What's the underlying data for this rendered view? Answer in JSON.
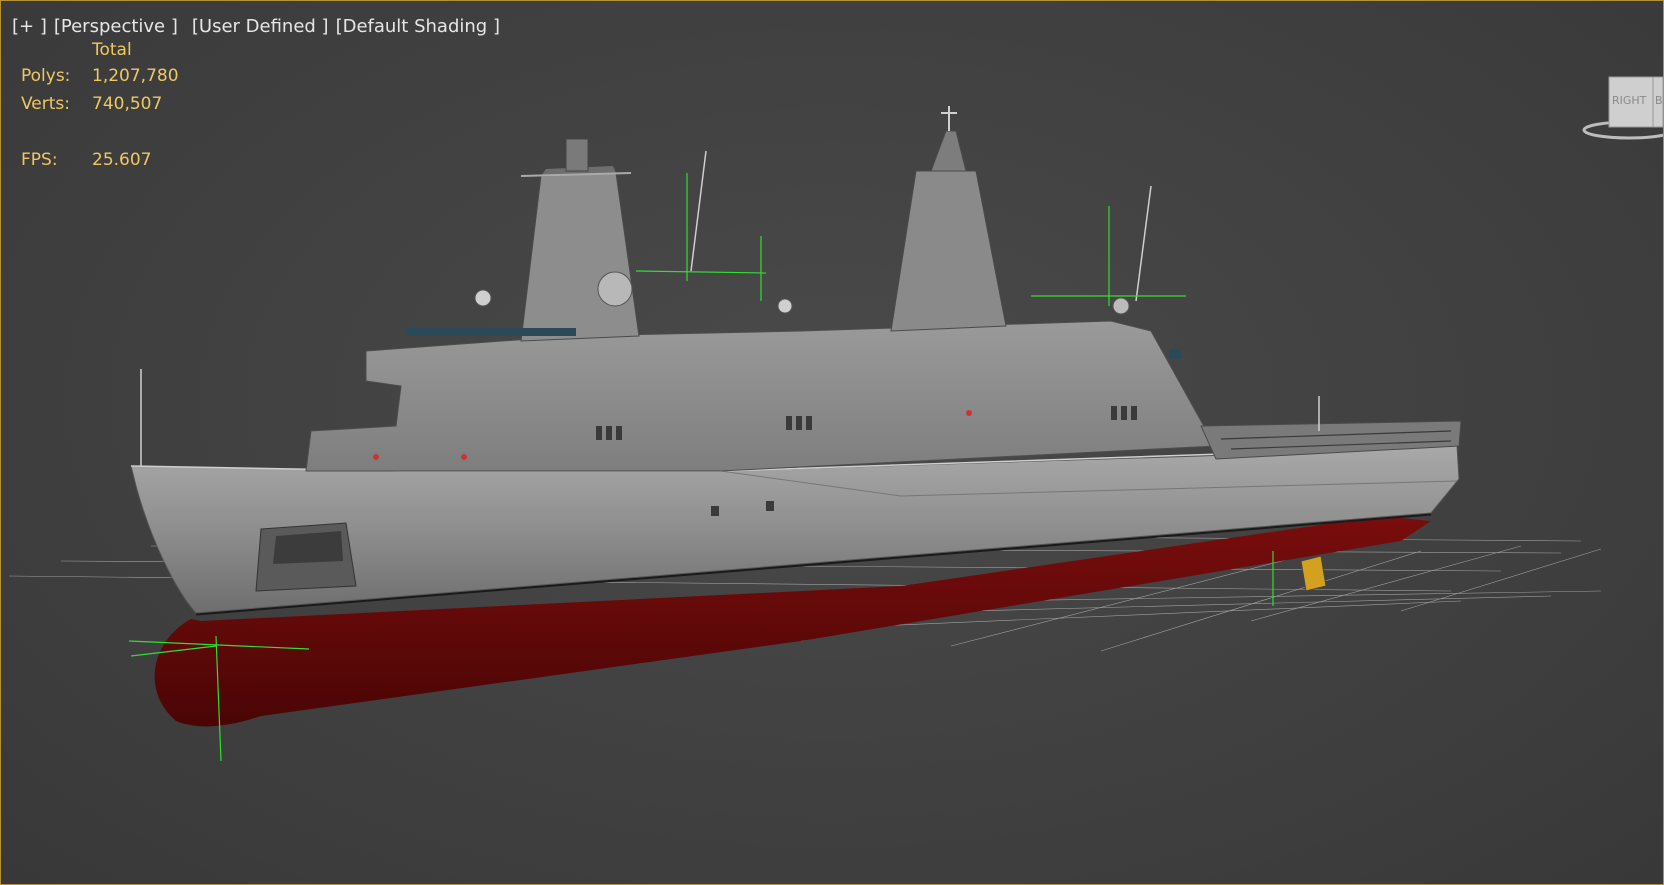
{
  "viewport": {
    "menu_label": "[+ ]",
    "view_label": "[Perspective ]",
    "lighting_label": "[User Defined ]",
    "shading_label": "[Default Shading ]"
  },
  "stats": {
    "header": "Total",
    "polys_label": "Polys:",
    "polys_value": "1,207,780",
    "verts_label": "Verts:",
    "verts_value": "740,507",
    "fps_label": "FPS:",
    "fps_value": "25.607"
  },
  "viewcube": {
    "face_label": "RIGHT",
    "partial_face_label": "BA"
  },
  "colors": {
    "border": "#b8912f",
    "stats_text": "#f0c860",
    "label_text": "#e6e6e6",
    "hull_red": "#6a0a0a",
    "ship_gray": "#8c8c8c",
    "gizmo_green": "#2fe02f",
    "grid_line": "#cfcfcf"
  }
}
